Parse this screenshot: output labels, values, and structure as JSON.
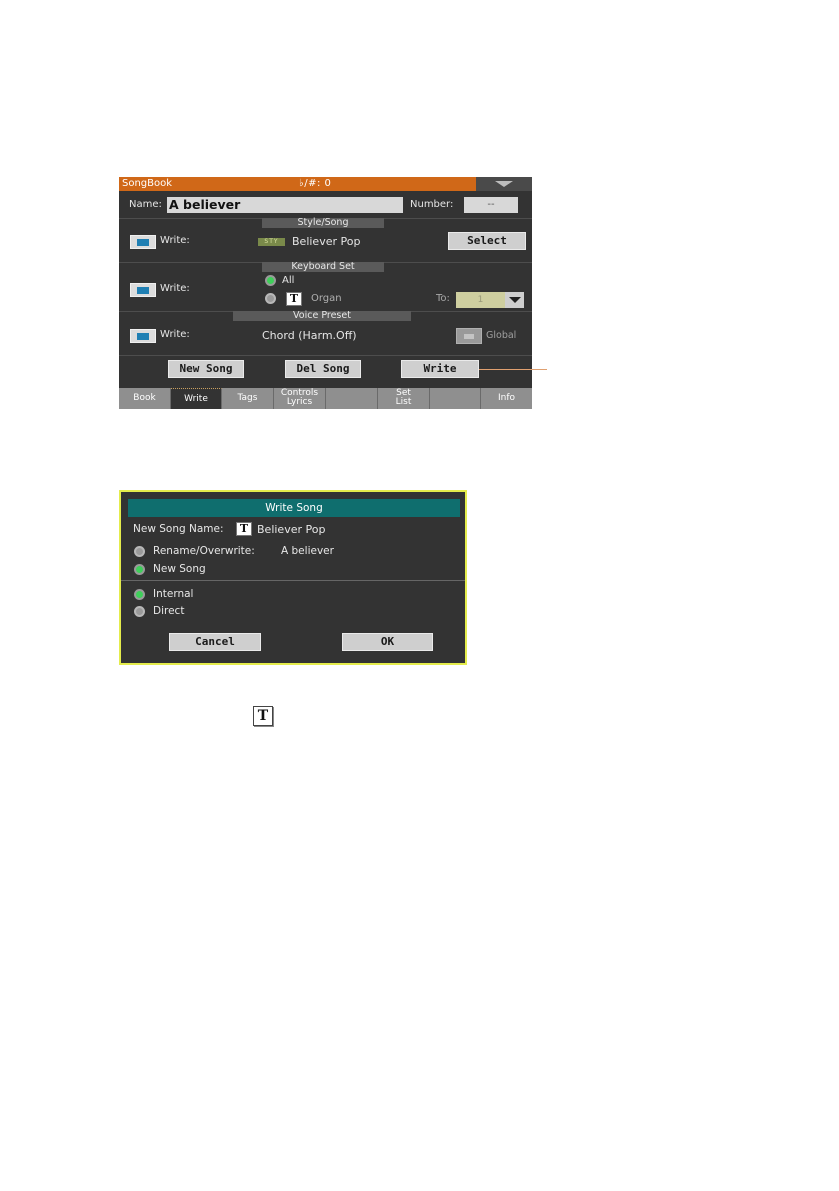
{
  "songbook": {
    "title": "SongBook",
    "key_indicator": "♭/#: 0",
    "name_label": "Name:",
    "name_value": "A believer",
    "number_label": "Number:",
    "number_value": "--",
    "style_song": {
      "section": "Style/Song",
      "write_label": "Write:",
      "badge": "STY",
      "value": "Believer Pop",
      "select_button": "Select"
    },
    "keyboard_set": {
      "section": "Keyboard Set",
      "write_label": "Write:",
      "option_all": "All",
      "option_single": "Organ",
      "to_label": "To:",
      "to_value": "1"
    },
    "voice_preset": {
      "section": "Voice Preset",
      "write_label": "Write:",
      "value": "Chord (Harm.Off)",
      "global_label": "Global"
    },
    "buttons": {
      "new_song": "New Song",
      "del_song": "Del Song",
      "write": "Write"
    },
    "tabs": [
      {
        "line1": "Book",
        "line2": ""
      },
      {
        "line1": "Write",
        "line2": ""
      },
      {
        "line1": "Tags",
        "line2": ""
      },
      {
        "line1": "Controls",
        "line2": "Lyrics"
      },
      {
        "line1": "",
        "line2": ""
      },
      {
        "line1": "Set",
        "line2": "List"
      },
      {
        "line1": "",
        "line2": ""
      },
      {
        "line1": "Info",
        "line2": ""
      }
    ],
    "active_tab": "Write"
  },
  "write_dialog": {
    "title": "Write Song",
    "new_name_label": "New Song Name:",
    "new_name_value": "Believer Pop",
    "option_rename": "Rename/Overwrite:",
    "rename_target": "A believer",
    "option_new": "New Song",
    "option_internal": "Internal",
    "option_direct": "Direct",
    "cancel_button": "Cancel",
    "ok_button": "OK"
  },
  "text_icon_glyph": "T",
  "colors": {
    "title_bar": "#d06818",
    "dialog_title": "#0f6e6e",
    "dialog_border": "#e4ec4c",
    "radio_on": "#3fcf5a",
    "callout_line": "#e0a070"
  }
}
